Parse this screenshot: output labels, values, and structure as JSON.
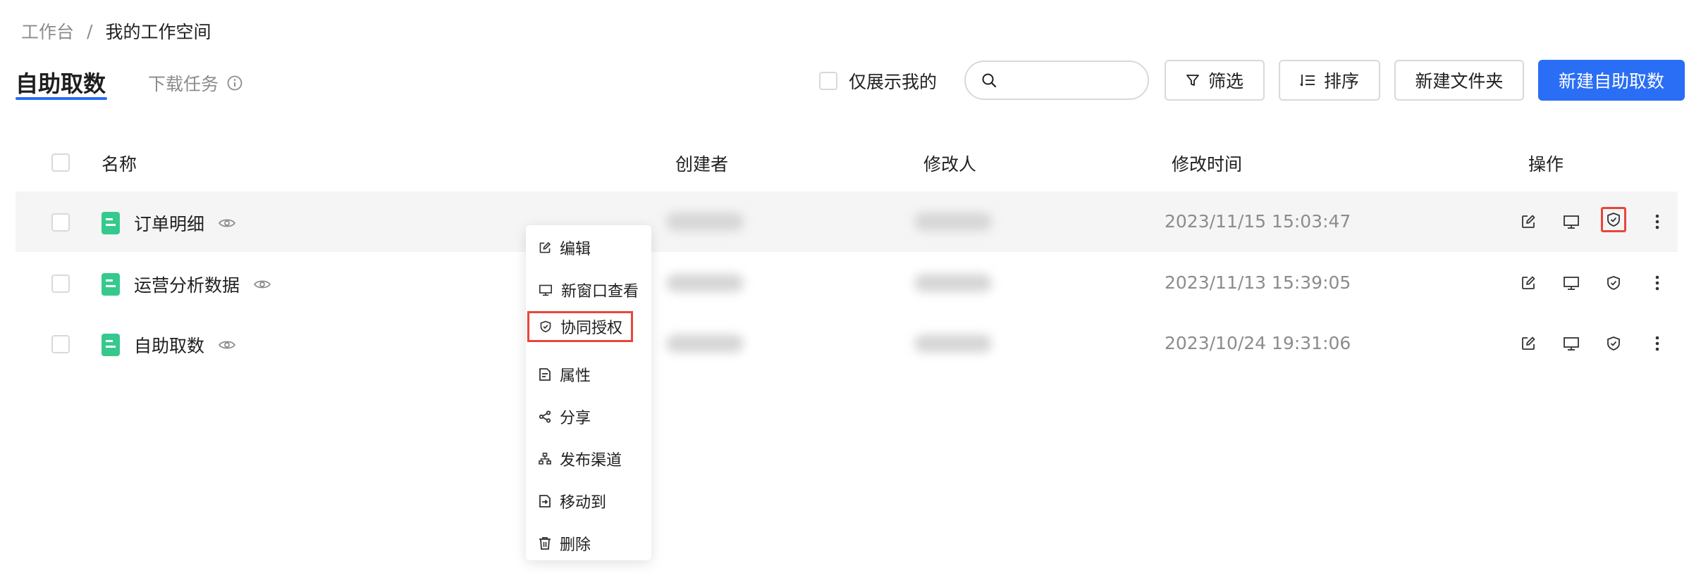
{
  "breadcrumb": {
    "root": "工作台",
    "separator": "/",
    "current": "我的工作空间"
  },
  "tabs": {
    "active": "自助取数",
    "inactive": "下载任务"
  },
  "toolbar": {
    "only_mine_label": "仅展示我的",
    "search_placeholder": "",
    "filter_label": "筛选",
    "sort_label": "排序",
    "new_folder_label": "新建文件夹",
    "new_button_label": "新建自助取数"
  },
  "table": {
    "columns": {
      "name": "名称",
      "creator": "创建者",
      "modifier": "修改人",
      "modified_time": "修改时间",
      "actions": "操作"
    },
    "rows": [
      {
        "name": "订单明细",
        "modified_time": "2023/11/15 15:03:47"
      },
      {
        "name": "运营分析数据",
        "modified_time": "2023/11/13 15:39:05"
      },
      {
        "name": "自助取数",
        "modified_time": "2023/10/24 19:31:06"
      }
    ]
  },
  "context_menu": {
    "items": [
      "编辑",
      "新窗口查看",
      "协同授权",
      "属性",
      "分享",
      "发布渠道",
      "移动到",
      "删除"
    ]
  },
  "colors": {
    "primary": "#2a6ef5",
    "file_icon": "#36c98d",
    "highlight": "#e8463a"
  }
}
